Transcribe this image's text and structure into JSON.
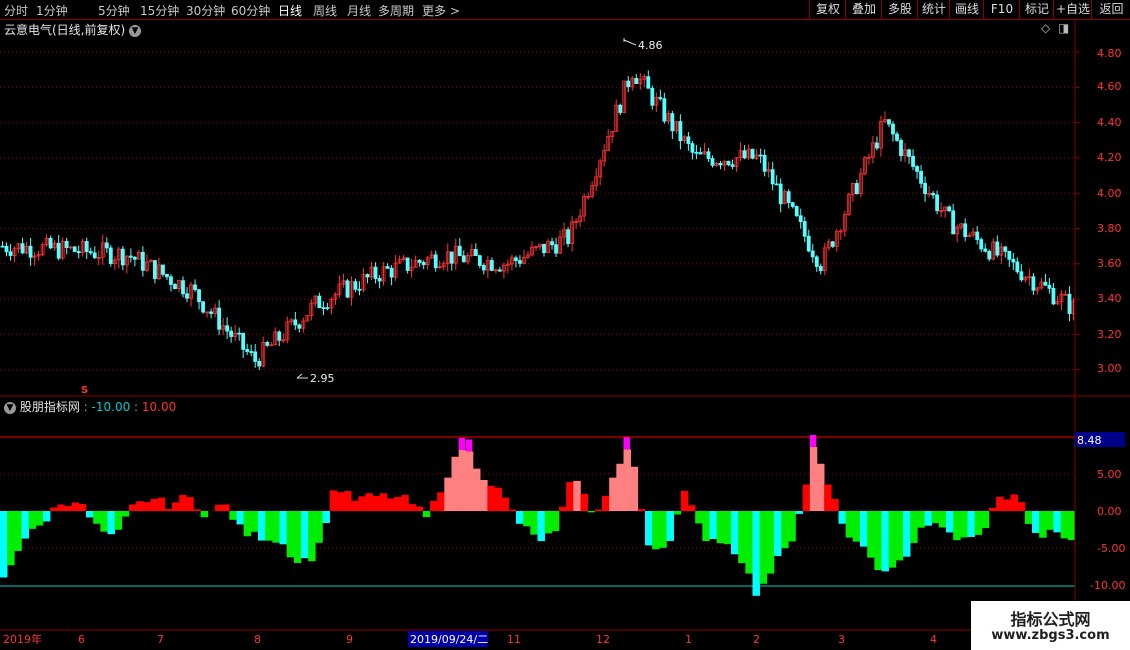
{
  "toolbar": {
    "periods": [
      {
        "label": "分时",
        "active": false
      },
      {
        "label": "1分钟",
        "active": false
      },
      {
        "label": "5分钟",
        "active": false
      },
      {
        "label": "15分钟",
        "active": false
      },
      {
        "label": "30分钟",
        "active": false
      },
      {
        "label": "60分钟",
        "active": false
      },
      {
        "label": "日线",
        "active": true
      },
      {
        "label": "周线",
        "active": false
      },
      {
        "label": "月线",
        "active": false
      },
      {
        "label": "多周期",
        "active": false
      },
      {
        "label": "更多 >",
        "active": false
      }
    ],
    "tools": [
      "复权",
      "叠加",
      "多股",
      "统计",
      "画线",
      "F10",
      "标记",
      "+自选",
      "返回"
    ]
  },
  "main_panel": {
    "title": "云意电气(日线,前复权)",
    "y_labels": [
      "4.80",
      "4.60",
      "4.40",
      "4.20",
      "4.00",
      "3.80",
      "3.60",
      "3.40",
      "3.20",
      "3.00"
    ],
    "high_label": "4.86",
    "low_label": "2.95",
    "signal_mark": "S"
  },
  "indicator_panel": {
    "title": "股朋指标网",
    "range_min": "-10.00",
    "range_max": "10.00",
    "y_labels": [
      "5.00",
      "0.00",
      "-5.00",
      "-10.00"
    ],
    "current_value": "8.48"
  },
  "date_axis": {
    "labels": [
      "2019年",
      "6",
      "7",
      "8",
      "9",
      "11",
      "12",
      "1",
      "2",
      "3",
      "4"
    ],
    "cursor_date": "2019/09/24/二"
  },
  "watermark": {
    "line1": "指标公式网",
    "line2": "www.zbgs3.com"
  },
  "colors": {
    "up_candle": "#ff3333",
    "down_candle": "#55ffff",
    "pos_bar": "#ff0000",
    "pos_bar_light": "#ff8080",
    "neg_bar": "#00ee00",
    "neg_bar_cyan": "#00ffff",
    "spike": "#ff00ff",
    "upper_line": "#ff0000",
    "lower_line": "#00cccc",
    "grid": "#8b0000"
  },
  "chart_data": [
    {
      "type": "line",
      "title": "云意电气(日线,前复权)",
      "x": [
        "2019年",
        "6",
        "7",
        "8",
        "9",
        "11",
        "12",
        "1",
        "2",
        "3",
        "4"
      ],
      "series": [
        {
          "values": [
            3.7,
            3.68,
            3.65,
            3.45,
            3.05,
            3.38,
            3.55,
            3.65,
            3.6,
            3.75,
            4.7,
            4.2,
            4.2,
            3.6,
            4.4,
            3.85,
            3.6,
            3.35
          ]
        }
      ],
      "ylim": [
        2.9,
        4.9
      ],
      "annotations": [
        {
          "label": "4.86",
          "value": 4.86
        },
        {
          "label": "2.95",
          "value": 2.95
        }
      ]
    },
    {
      "type": "bar",
      "title": "股朋指标网",
      "series": [
        {
          "values": [
            -9,
            -4,
            -2,
            1,
            1.5,
            -2,
            -4,
            0.5,
            1.8,
            0.8,
            2,
            -0.5,
            1,
            -3,
            -3.5,
            -4,
            -7,
            -6,
            3.5,
            1.5,
            2,
            2,
            1.5,
            -1,
            4.5,
            9,
            5,
            2.5,
            -1.5,
            -4,
            -3,
            5.5,
            -1,
            4,
            9,
            -4.5,
            -5,
            2.5,
            -3.5,
            -4,
            -6,
            -12,
            -6,
            -3,
            8.5,
            2,
            -4,
            -6,
            -9,
            -6,
            -1.5,
            -2.5,
            -4,
            -3.5,
            1.5,
            2.5,
            -3.5,
            -3,
            -4
          ]
        }
      ],
      "ylim": [
        -12,
        12
      ]
    }
  ]
}
